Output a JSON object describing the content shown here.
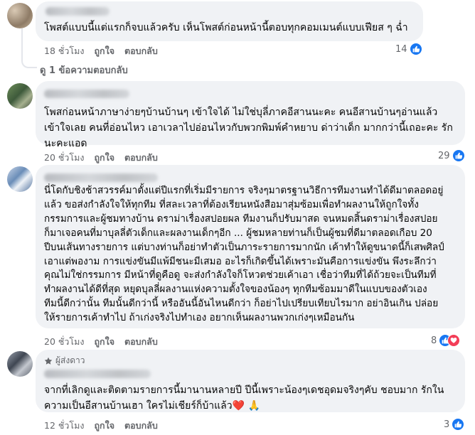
{
  "comments": [
    {
      "text": "โพสต์แบบนี้แต่แรกก็จบแล้วครับ เห็นโพสต์ก่อนหน้านี้ตอบทุกคอมเมนต์แบบเฟียส ๆ ฉ่ำ",
      "time": "18 ชั่วโมง",
      "like_label": "ถูกใจ",
      "reply_label": "ตอบกลับ",
      "reaction_count": "14",
      "replies_label": "ดู 1 ข้อความตอบกลับ"
    },
    {
      "text": "โพสก่อนหน้าภาษาง่ายๆบ้านบ้านๆ เข้าใจได้ ไม่ใช่บุลี่ภาคอีสานนะคะ คนอีสานบ้านๆอ่านแล้ว\nเข้าใจเลย คนที่อ่อนไหว เอาเวลาไปอ่อนไหวกับพวกพิมพ์คำหยาบ ด่าว่าเด็ก มากกว่านี้เถอะคะ รัก\nนะคะแอด",
      "time": "20 ชั่วโมง",
      "like_label": "ถูกใจ",
      "reply_label": "ตอบกลับ",
      "reaction_count": "29"
    },
    {
      "text": "นี่โดกับชิงช้าสวรรค์มาตั้งแต่ปีแรกที่เริ่มมีรายการ จริงๆมาตรฐานวิธีการทีมงานทำได้ดีมาตลอดอยู่\nแล้ว ขอส่งกำลังใจให้ทุกทีม ที่สละเวลาที่ต้องเรียนหนังสือมาสุ่มซ้อมเพื่อทำผลงานให้ถูกใจทั้ง\nกรรมการและผู้ชมทางบ้าน ดราม่าเรื่องสปอยผล ทีมงานก็ปรับมาสด จนหมดสิ้นดราม่าเรื่องสปอย\nก็มาเจอคนที่มาบุลลี่ตัวเด็กและผลงานเด็กๆอีก ... ผู้ชมหลายท่านก็เป็นผู้ชมที่ดีมาตลอดเกือบ 20\nปีบนเส้นทางรายการ แต่บางท่านก็อย่าทำตัวเป็นภาระรายการมากนัก เค้าทำให้ดูขนาดนี้ก็เสพศิลป์\nเอาแต่พองาม การแข่งขันมีแพ้มีชนะมีเสมอ อะไรก็เกิดขึ้นได้เพราะมันคือการแข่งขัน พึงระลึกว่า\nคุณไม่ใช่กรรมการ มีหน้าที่ดูคือดู จะส่งกำลังใจก็โหวตช่วยเค้าเอา เชื่อว่าทีมที่ได้ถ้วยจะเป็นทีมที่\nทำผลงานได้ดีที่สุด หยุดบุลลี่ผลงานแห่งความตั้งใจของน้องๆ ทุกทีมซ้อมมาดีในแบบของตัวเอง\nทีมนี้ดีกว่านั้น ทีมนั้นดีกว่านี้ หรืออันนี้อันไหนดีกว่า ก็อย่าไปเปรียบเทียบไรมาก อย่าอินเกิน ปล่อย\nให้รายการเค้าทำไป ถ้าเก่งจริงไปทำเอง อยากเห็นผลงานพวกเก่งๆเหมือนกัน",
      "time": "20 ชั่วโมง",
      "like_label": "ถูกใจ",
      "reply_label": "ตอบกลับ",
      "reaction_count": "8"
    },
    {
      "badge": "ผู้ส่งดาว",
      "text": "จากที่เลิกดูและติดตามรายการนี้มานานหลายปี ปีนี้เพราะน้องๆเดชอุดมจริงๆคับ ชอบมาก รักใน\nความเป็นอีสานบ้านเฮา ใครไม่เชียร์ก็บ้าแล้ว❤️ 🙏",
      "time": "12 ชั่วโมง",
      "like_label": "ถูกใจ",
      "reply_label": "ตอบกลับ",
      "reaction_count": "3"
    }
  ],
  "colors": {
    "like_blue": "#1877f2",
    "heart_red": "#f33e58",
    "bubble_bg": "#f0f2f5",
    "meta_gray": "#65676b"
  },
  "icons": {
    "like": "thumbs-up-icon",
    "heart": "heart-icon",
    "star": "star-icon"
  }
}
